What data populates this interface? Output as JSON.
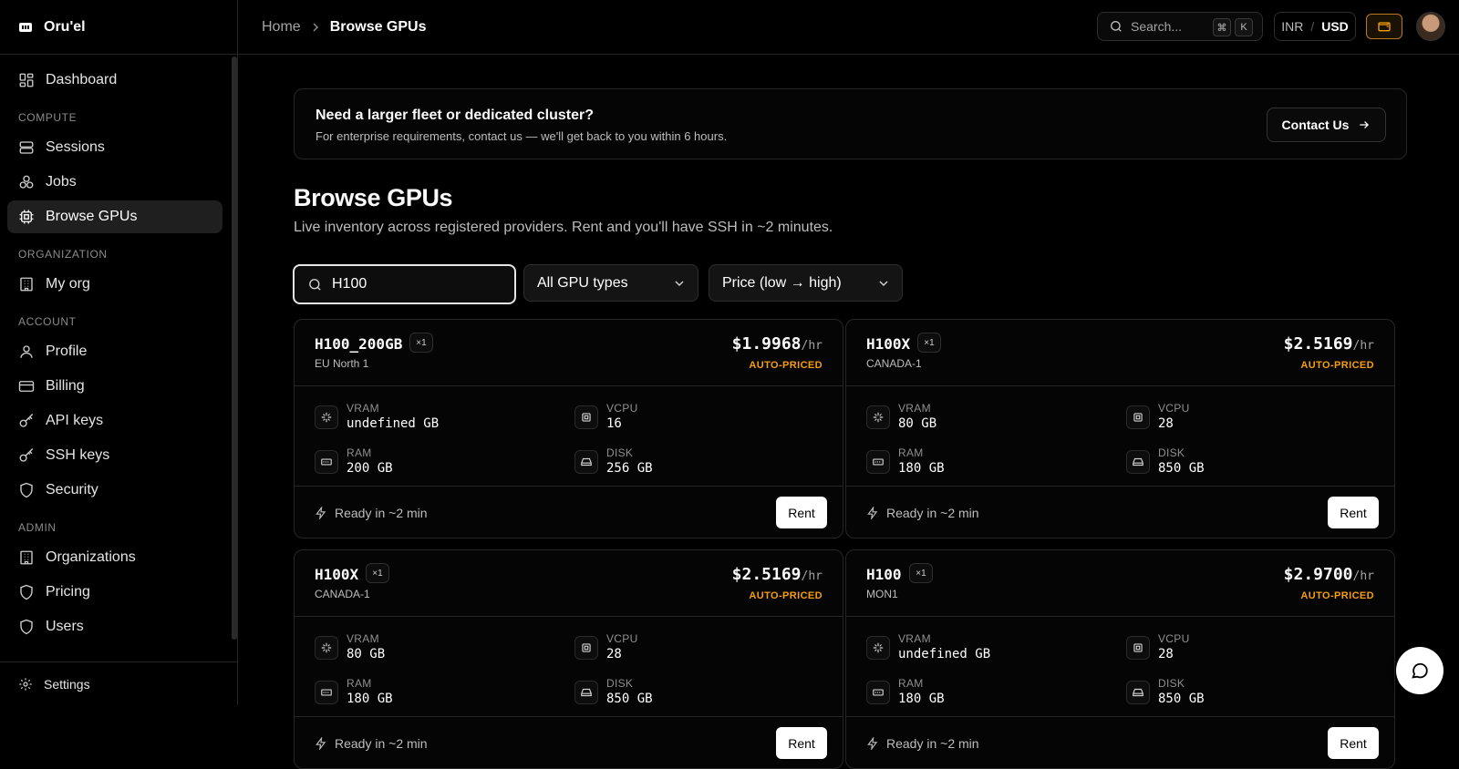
{
  "brand": {
    "name": "Oru'el",
    "logo_icon": "logo-icon"
  },
  "sidebar": {
    "top_item": {
      "label": "Dashboard",
      "icon": "grid-icon"
    },
    "sections": [
      {
        "title": "COMPUTE",
        "items": [
          {
            "label": "Sessions",
            "icon": "server-icon"
          },
          {
            "label": "Jobs",
            "icon": "boxes-icon"
          },
          {
            "label": "Browse GPUs",
            "icon": "cpu-icon",
            "active": true
          }
        ]
      },
      {
        "title": "ORGANIZATION",
        "items": [
          {
            "label": "My org",
            "icon": "building-icon"
          }
        ]
      },
      {
        "title": "ACCOUNT",
        "items": [
          {
            "label": "Profile",
            "icon": "user-icon"
          },
          {
            "label": "Billing",
            "icon": "credit-card-icon"
          },
          {
            "label": "API keys",
            "icon": "key-icon"
          },
          {
            "label": "SSH keys",
            "icon": "key-icon"
          },
          {
            "label": "Security",
            "icon": "shield-icon"
          }
        ]
      },
      {
        "title": "ADMIN",
        "items": [
          {
            "label": "Organizations",
            "icon": "building-icon"
          },
          {
            "label": "Pricing",
            "icon": "shield-icon"
          },
          {
            "label": "Users",
            "icon": "shield-icon"
          }
        ]
      }
    ],
    "footer": {
      "label": "Settings",
      "icon": "gear-icon"
    }
  },
  "header": {
    "breadcrumb": {
      "home": "Home",
      "current": "Browse GPUs"
    },
    "search": {
      "placeholder": "Search...",
      "kbd_mod": "⌘",
      "kbd_key": "K"
    },
    "currency": {
      "inr": "INR",
      "sep": "/",
      "usd": "USD"
    }
  },
  "banner": {
    "title": "Need a larger fleet or dedicated cluster?",
    "subtitle": "For enterprise requirements, contact us — we'll get back to you within 6 hours.",
    "button": "Contact Us"
  },
  "page": {
    "title": "Browse GPUs",
    "subtitle": "Live inventory across registered providers. Rent and you'll have SSH in ~2 minutes."
  },
  "filters": {
    "search_value": "H100",
    "gpu_type": "All GPU types",
    "sort": "Price (low → high)"
  },
  "labels": {
    "unit": "/hr",
    "auto": "AUTO-PRICED",
    "vram": "VRAM",
    "vcpu": "VCPU",
    "ram": "RAM",
    "disk": "DISK",
    "ready": "Ready in ~2 min",
    "rent": "Rent"
  },
  "cards": [
    {
      "name": "H100_200GB",
      "count": "×1",
      "region": "EU North 1",
      "price": "$1.9968",
      "vram": "undefined GB",
      "vcpu": "16",
      "ram": "200 GB",
      "disk": "256 GB"
    },
    {
      "name": "H100X",
      "count": "×1",
      "region": "CANADA-1",
      "price": "$2.5169",
      "vram": "80 GB",
      "vcpu": "28",
      "ram": "180 GB",
      "disk": "850 GB"
    },
    {
      "name": "H100X",
      "count": "×1",
      "region": "CANADA-1",
      "price": "$2.5169",
      "vram": "80 GB",
      "vcpu": "28",
      "ram": "180 GB",
      "disk": "850 GB"
    },
    {
      "name": "H100",
      "count": "×1",
      "region": "MON1",
      "price": "$2.9700",
      "vram": "undefined GB",
      "vcpu": "28",
      "ram": "180 GB",
      "disk": "850 GB"
    }
  ],
  "colors": {
    "accent": "#f59e0b",
    "background": "#000000",
    "border": "#262626"
  }
}
